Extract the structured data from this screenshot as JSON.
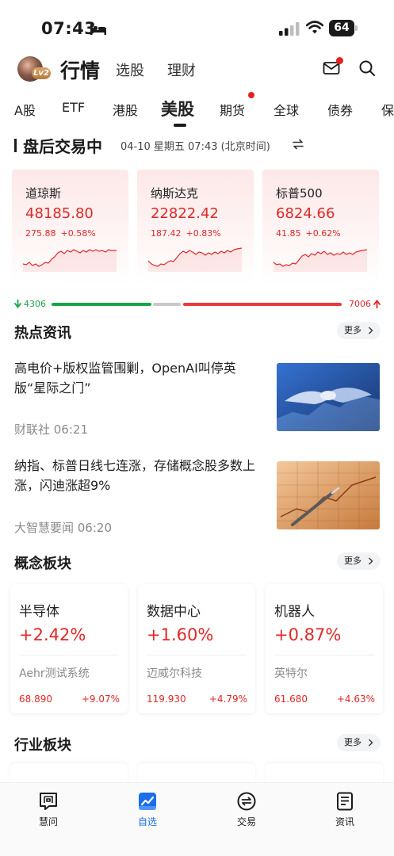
{
  "status_bar": {
    "time": "07:43",
    "battery": "64"
  },
  "header": {
    "level_badge": "Lv2",
    "title": "行情",
    "tabs": [
      "选股",
      "理财"
    ]
  },
  "market_tabs": [
    "A股",
    "ETF",
    "港股",
    "美股",
    "期货",
    "全球",
    "债券",
    "保"
  ],
  "session": {
    "title": "盘后交易中",
    "datetime": "04-10 星期五 07:43 (北京时间)"
  },
  "indices": [
    {
      "name": "道琼斯",
      "value": "48185.80",
      "change": "275.88",
      "pct": "+0.58%"
    },
    {
      "name": "纳斯达克",
      "value": "22822.42",
      "change": "187.42",
      "pct": "+0.83%"
    },
    {
      "name": "标普500",
      "value": "6824.66",
      "change": "41.85",
      "pct": "+0.62%"
    }
  ],
  "breadth": {
    "down": "4306",
    "up": "7006"
  },
  "hot_news": {
    "title": "热点资讯",
    "more": "更多",
    "items": [
      {
        "title": "高电价+版权监管围剿，OpenAI叫停英版“星际之门”",
        "source": "财联社 06:21"
      },
      {
        "title": "纳指、标普日线七连涨，存储概念股多数上涨，闪迪涨超9%",
        "source": "大智慧要闻 06:20"
      }
    ]
  },
  "concepts": {
    "title": "概念板块",
    "more": "更多",
    "items": [
      {
        "name": "半导体",
        "pct": "+2.42%",
        "stock": "Aehr测试系统",
        "price": "68.890",
        "chg": "+9.07%"
      },
      {
        "name": "数据中心",
        "pct": "+1.60%",
        "stock": "迈威尔科技",
        "price": "119.930",
        "chg": "+4.79%"
      },
      {
        "name": "机器人",
        "pct": "+0.87%",
        "stock": "英特尔",
        "price": "61.680",
        "chg": "+4.63%"
      }
    ]
  },
  "industry": {
    "title": "行业板块",
    "more": "更多"
  },
  "bottom_nav": [
    {
      "label": "慧问"
    },
    {
      "label": "自选"
    },
    {
      "label": "交易"
    },
    {
      "label": "资讯"
    }
  ],
  "colors": {
    "up": "#e02828",
    "down": "#1aa44a",
    "active_nav": "#1a6ee8"
  }
}
